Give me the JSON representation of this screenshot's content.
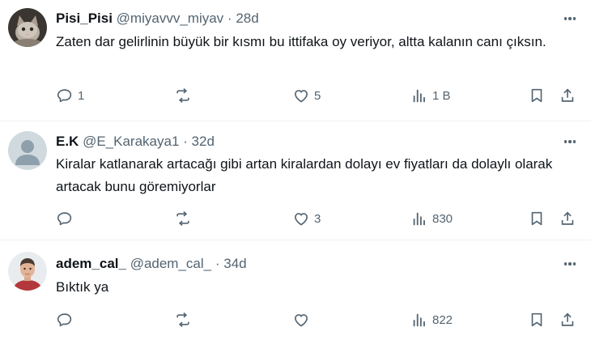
{
  "colors": {
    "text": "#0f1419",
    "muted": "#536471",
    "divider": "#eff3f4"
  },
  "tweets": [
    {
      "name": "Pisi_Pisi",
      "handle": "@miyavvv_miyav",
      "dot": "·",
      "time": "28d",
      "text": "Zaten dar gelirlinin büyük bir kısmı bu ittifaka oy veriyor, altta kalanın canı çıksın.",
      "avatar": "cat-photo",
      "replies": "1",
      "reposts": "",
      "likes": "5",
      "views": "1 B"
    },
    {
      "name": "E.K",
      "handle": "@E_Karakaya1",
      "dot": "·",
      "time": "32d",
      "text": "Kiralar katlanarak artacağı gibi artan kiralardan dolayı ev fiyatları da dolaylı olarak artacak bunu göremiyorlar",
      "avatar": "default-avatar",
      "replies": "",
      "reposts": "",
      "likes": "3",
      "views": "830"
    },
    {
      "name": "adem_cal_",
      "handle": "@adem_cal_",
      "dot": "·",
      "time": "34d",
      "text": "Bıktık ya",
      "avatar": "man-photo",
      "replies": "",
      "reposts": "",
      "likes": "",
      "views": "822"
    }
  ]
}
